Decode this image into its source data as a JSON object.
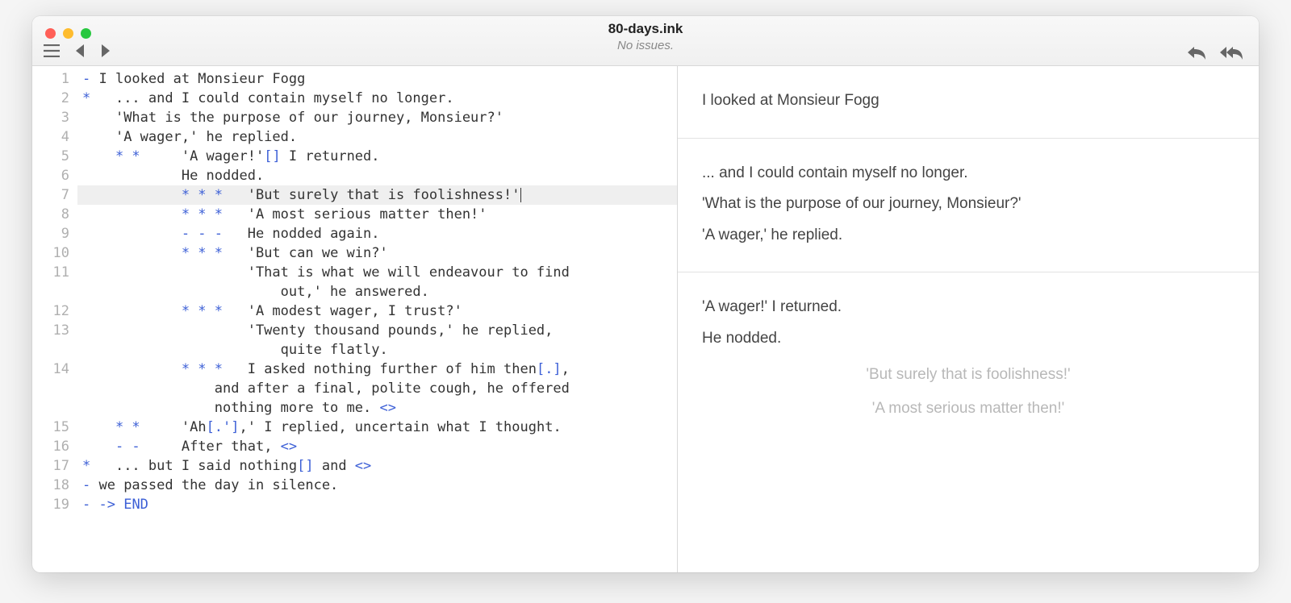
{
  "window": {
    "title": "80-days.ink",
    "status": "No issues."
  },
  "editor": {
    "highlight_line": 7,
    "lines": [
      {
        "n": 1,
        "segments": [
          {
            "t": "- ",
            "c": "tok-bullet"
          },
          {
            "t": "I looked at Monsieur Fogg"
          }
        ]
      },
      {
        "n": 2,
        "segments": [
          {
            "t": "*   ",
            "c": "tok-bullet"
          },
          {
            "t": "... and I could contain myself no longer."
          }
        ]
      },
      {
        "n": 3,
        "segments": [
          {
            "t": "    "
          },
          {
            "t": "'What is the purpose of our journey, Monsieur?'"
          }
        ]
      },
      {
        "n": 4,
        "segments": [
          {
            "t": "    "
          },
          {
            "t": "'A wager,' he replied."
          }
        ]
      },
      {
        "n": 5,
        "segments": [
          {
            "t": "    "
          },
          {
            "t": "* *     ",
            "c": "tok-bullet"
          },
          {
            "t": "'A wager!'"
          },
          {
            "t": "[]",
            "c": "tok-bracket"
          },
          {
            "t": " I returned."
          }
        ]
      },
      {
        "n": 6,
        "segments": [
          {
            "t": "            "
          },
          {
            "t": "He nodded."
          }
        ]
      },
      {
        "n": 7,
        "segments": [
          {
            "t": "            "
          },
          {
            "t": "* * *   ",
            "c": "tok-bullet"
          },
          {
            "t": "'But surely that is foolishness!'"
          }
        ],
        "cursor": true
      },
      {
        "n": 8,
        "segments": [
          {
            "t": "            "
          },
          {
            "t": "* * *   ",
            "c": "tok-bullet"
          },
          {
            "t": "'A most serious matter then!'"
          }
        ]
      },
      {
        "n": 9,
        "segments": [
          {
            "t": "            "
          },
          {
            "t": "- - -   ",
            "c": "tok-bullet"
          },
          {
            "t": "He nodded again."
          }
        ]
      },
      {
        "n": 10,
        "segments": [
          {
            "t": "            "
          },
          {
            "t": "* * *   ",
            "c": "tok-bullet"
          },
          {
            "t": "'But can we win?'"
          }
        ]
      },
      {
        "n": 11,
        "segments": [
          {
            "t": "                    "
          },
          {
            "t": "'That is what we will endeavour to find"
          }
        ]
      },
      {
        "n": "",
        "segments": [
          {
            "t": "                        "
          },
          {
            "t": "out,' he answered."
          }
        ]
      },
      {
        "n": 12,
        "segments": [
          {
            "t": "            "
          },
          {
            "t": "* * *   ",
            "c": "tok-bullet"
          },
          {
            "t": "'A modest wager, I trust?'"
          }
        ]
      },
      {
        "n": 13,
        "segments": [
          {
            "t": "                    "
          },
          {
            "t": "'Twenty thousand pounds,' he replied,"
          }
        ]
      },
      {
        "n": "",
        "segments": [
          {
            "t": "                        "
          },
          {
            "t": "quite flatly."
          }
        ]
      },
      {
        "n": 14,
        "segments": [
          {
            "t": "            "
          },
          {
            "t": "* * *   ",
            "c": "tok-bullet"
          },
          {
            "t": "I asked nothing further of him then"
          },
          {
            "t": "[.]",
            "c": "tok-bracket"
          },
          {
            "t": ","
          }
        ]
      },
      {
        "n": "",
        "segments": [
          {
            "t": "                "
          },
          {
            "t": "and after a final, polite cough, he offered"
          }
        ]
      },
      {
        "n": "",
        "segments": [
          {
            "t": "                "
          },
          {
            "t": "nothing more to me. "
          },
          {
            "t": "<>",
            "c": "tok-divert"
          }
        ]
      },
      {
        "n": 15,
        "segments": [
          {
            "t": "    "
          },
          {
            "t": "* *     ",
            "c": "tok-bullet"
          },
          {
            "t": "'Ah"
          },
          {
            "t": "[.']",
            "c": "tok-bracket"
          },
          {
            "t": ",' I replied, uncertain what I thought."
          }
        ]
      },
      {
        "n": 16,
        "segments": [
          {
            "t": "    "
          },
          {
            "t": "- -     ",
            "c": "tok-bullet"
          },
          {
            "t": "After that, "
          },
          {
            "t": "<>",
            "c": "tok-divert"
          }
        ]
      },
      {
        "n": 17,
        "segments": [
          {
            "t": "*   ",
            "c": "tok-bullet"
          },
          {
            "t": "... but I said nothing"
          },
          {
            "t": "[]",
            "c": "tok-bracket"
          },
          {
            "t": " and "
          },
          {
            "t": "<>",
            "c": "tok-divert"
          }
        ]
      },
      {
        "n": 18,
        "segments": [
          {
            "t": "- ",
            "c": "tok-bullet"
          },
          {
            "t": "we passed the day in silence."
          }
        ]
      },
      {
        "n": 19,
        "segments": [
          {
            "t": "- ",
            "c": "tok-bullet"
          },
          {
            "t": "-> ",
            "c": "tok-divert"
          },
          {
            "t": "END",
            "c": "tok-divert"
          }
        ]
      }
    ]
  },
  "preview": {
    "blocks": [
      {
        "lines": [
          "I looked at Monsieur Fogg"
        ]
      },
      {
        "lines": [
          "... and I could contain myself no longer.",
          "'What is the purpose of our journey, Monsieur?'",
          "'A wager,' he replied."
        ]
      },
      {
        "lines": [
          "'A wager!' I returned.",
          "He nodded."
        ],
        "choices": [
          "'But surely that is foolishness!'",
          "'A most serious matter then!'"
        ]
      }
    ]
  }
}
